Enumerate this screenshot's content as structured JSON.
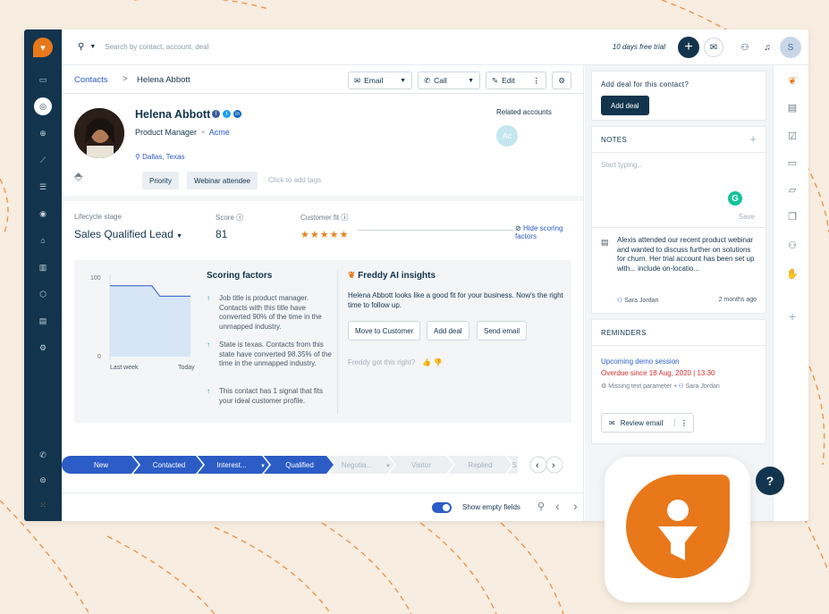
{
  "topbar": {
    "search_placeholder": "Search by contact, account, deal",
    "trial_text": "10 days free trial",
    "avatar_initial": "S"
  },
  "breadcrumb": {
    "parent": "Contacts",
    "separator": ">",
    "current": "Helena Abbott"
  },
  "actions": {
    "email": "Email",
    "call": "Call",
    "edit": "Edit"
  },
  "contact": {
    "name": "Helena Abbott",
    "job_title": "Product Manager",
    "company": "Acme",
    "location": "Dallas, Texas",
    "tags": [
      "Priority",
      "Webinar attendee"
    ],
    "add_tags_placeholder": "Click to add tags",
    "related_accounts_label": "Related accounts",
    "related_account_initials": "Ac"
  },
  "lifecycle": {
    "stage_label": "Lifecycle stage",
    "stage_value": "Sales Qualified Lead",
    "score_label": "Score",
    "score_value": "81",
    "fit_label": "Customer fit",
    "fit_stars": 5,
    "hide_scoring": "Hide scoring factors"
  },
  "chart_data": {
    "type": "line",
    "x": [
      "Last week",
      "Today"
    ],
    "ylim": [
      0,
      100
    ],
    "y_ticks": [
      "100",
      "0"
    ],
    "series": [
      {
        "values": [
          89,
          89,
          76,
          76
        ]
      }
    ]
  },
  "scoring_factors": {
    "title": "Scoring factors",
    "items": [
      "Job title is product manager. Contacts with this title have converted 90% of the time in the unmapped industry.",
      "State is texas. Contacts from this state have converted 98.35% of the time in the unmapped industry.",
      "This contact has 1 signal that fits your ideal customer profile."
    ]
  },
  "freddy": {
    "title": "Freddy AI insights",
    "body": "Helena Abbott looks like a good fit for your business. Now's the right time to follow up.",
    "buttons": [
      "Move to Customer",
      "Add deal",
      "Send email"
    ],
    "feedback": "Freddy got this right?"
  },
  "pipeline": {
    "stages": [
      "New",
      "Contacted",
      "Interest...",
      "Qualified",
      "Negotia...",
      "Visitor",
      "Replied",
      "S"
    ]
  },
  "footer": {
    "show_empty_fields": "Show empty fields"
  },
  "deal_card": {
    "prompt": "Add deal for this contact?",
    "button": "Add deal"
  },
  "notes": {
    "title": "NOTES",
    "placeholder": "Start typing...",
    "save": "Save",
    "note_text": "Alexis attended our recent product webinar and wanted to discuss further on solutions for churn. Her trial account has been set up with... include on-locatio...",
    "author": "Sara Jordan",
    "time": "2 months ago"
  },
  "reminders": {
    "title": "REMINDERS",
    "item_title": "Upcoming demo session",
    "overdue": "Overdue since 18 Aug, 2020 | 13:30",
    "missing": "Missing text parameter",
    "owner": "Sara Jordan",
    "review_button": "Review email"
  },
  "colors": {
    "navy": "#12344d",
    "link_blue": "#2c5cc5",
    "pipeline_blue": "#2c5cc5",
    "overdue_red": "#d72d30",
    "brand_orange": "#e8781a",
    "star_orange": "#e8831c"
  }
}
